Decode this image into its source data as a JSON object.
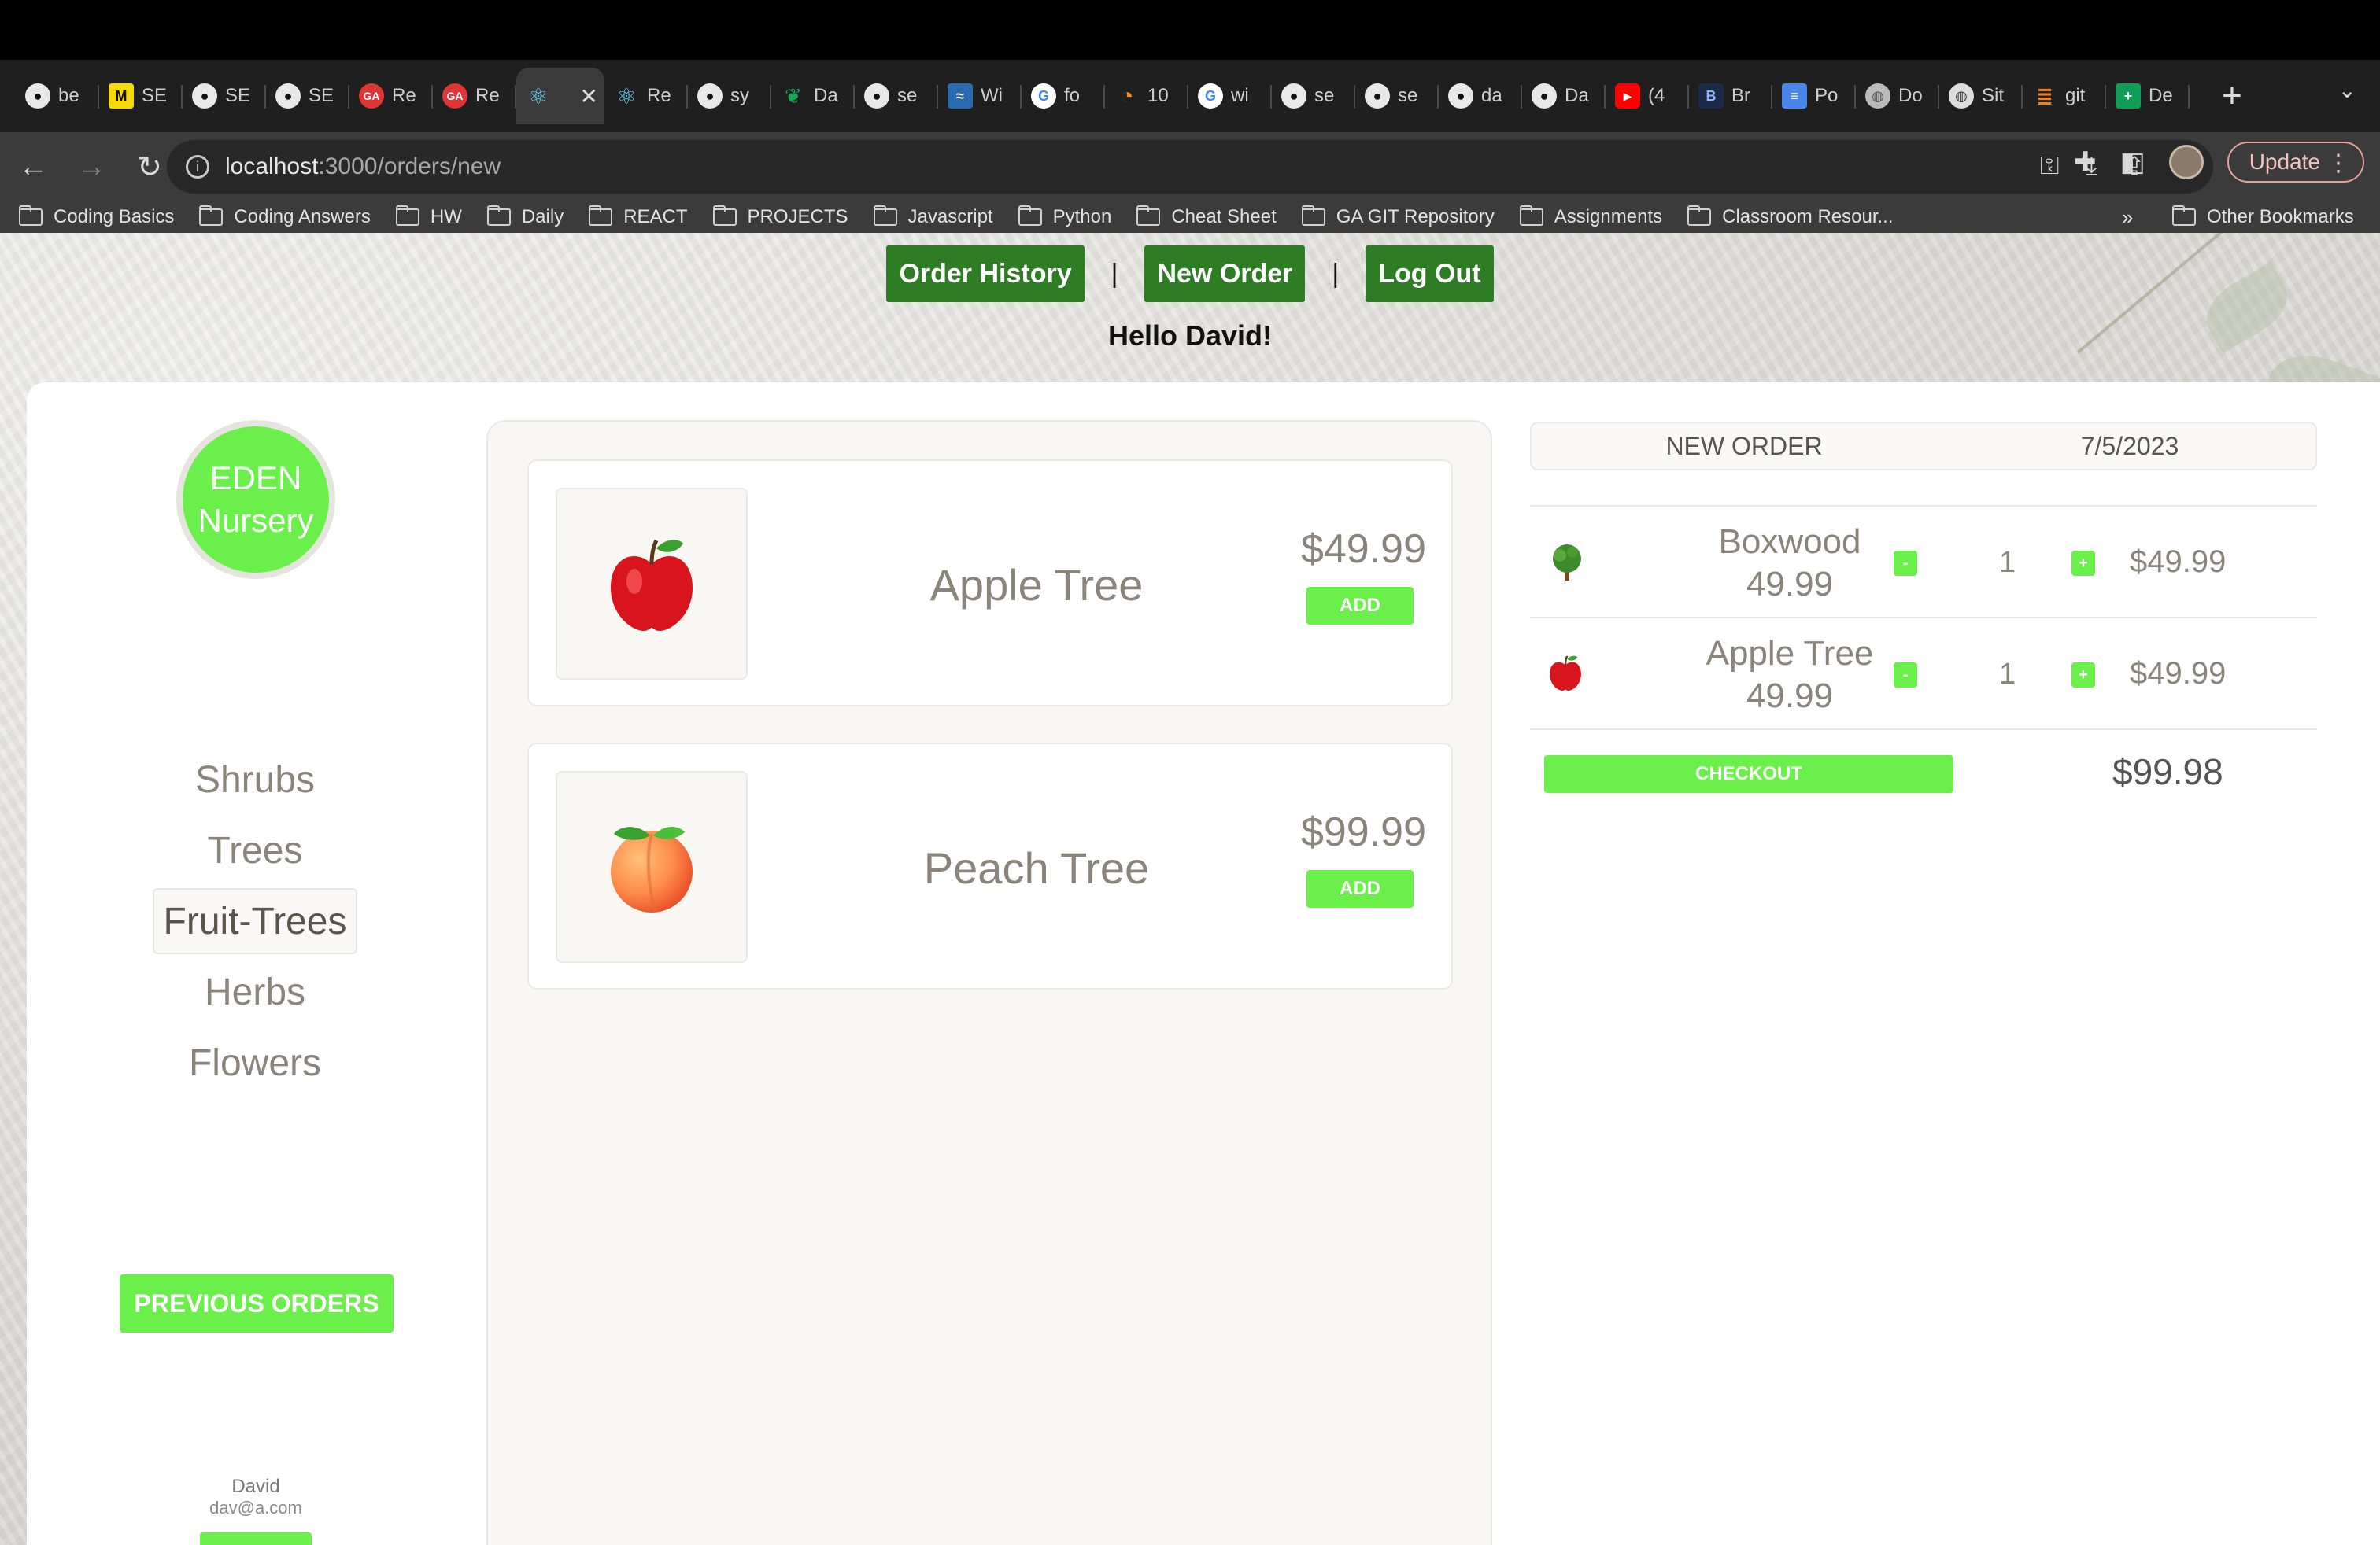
{
  "browser": {
    "tabs": [
      {
        "label": "be",
        "icon": "github-icon"
      },
      {
        "label": "SE",
        "icon": "miro-icon"
      },
      {
        "label": "SE",
        "icon": "github-icon"
      },
      {
        "label": "SE",
        "icon": "github-icon"
      },
      {
        "label": "Re",
        "icon": "ga-icon"
      },
      {
        "label": "Re",
        "icon": "ga-icon"
      },
      {
        "label": "",
        "icon": "react-icon",
        "active": true
      },
      {
        "label": "Re",
        "icon": "react-icon"
      },
      {
        "label": "sy",
        "icon": "github-icon"
      },
      {
        "label": "Da",
        "icon": "mongodb-icon"
      },
      {
        "label": "se",
        "icon": "github-icon"
      },
      {
        "label": "Wi",
        "icon": "wave-icon"
      },
      {
        "label": "fo",
        "icon": "google-icon"
      },
      {
        "label": "10",
        "icon": "timer-icon"
      },
      {
        "label": "wi",
        "icon": "google-icon"
      },
      {
        "label": "se",
        "icon": "github-icon"
      },
      {
        "label": "se",
        "icon": "github-icon"
      },
      {
        "label": "da",
        "icon": "github-icon"
      },
      {
        "label": "Da",
        "icon": "github-icon"
      },
      {
        "label": "(4",
        "icon": "youtube-icon"
      },
      {
        "label": "Br",
        "icon": "b-icon"
      },
      {
        "label": "Po",
        "icon": "docs-icon"
      },
      {
        "label": "Do",
        "icon": "globe-icon"
      },
      {
        "label": "Sit",
        "icon": "globe-icon"
      },
      {
        "label": "git",
        "icon": "stackoverflow-icon"
      },
      {
        "label": "De",
        "icon": "sheets-icon"
      }
    ],
    "url_host": "localhost",
    "url_path": ":3000/orders/new",
    "update_label": "Update",
    "bookmarks": [
      "Coding Basics",
      "Coding Answers",
      "HW",
      "Daily",
      "REACT",
      "PROJECTS",
      "Javascript",
      "Python",
      "Cheat Sheet",
      "GA GIT Repository",
      "Assignments",
      "Classroom Resour..."
    ],
    "bookmarks_more": "»",
    "other_bookmarks": "Other Bookmarks"
  },
  "header": {
    "links": [
      "Order History",
      "New Order",
      "Log Out"
    ],
    "separator": "|",
    "greeting": "Hello David!"
  },
  "sidebar": {
    "logo_line1": "EDEN",
    "logo_line2": "Nursery",
    "categories": [
      "Shrubs",
      "Trees",
      "Fruit-Trees",
      "Herbs",
      "Flowers"
    ],
    "active_category": "Fruit-Trees",
    "previous_orders_label": "PREVIOUS ORDERS",
    "user_name": "David",
    "user_email": "dav@a.com"
  },
  "menu": {
    "items": [
      {
        "emoji": "🍎",
        "name": "Apple Tree",
        "price": "$49.99",
        "add_label": "ADD"
      },
      {
        "emoji": "🍑",
        "name": "Peach Tree",
        "price": "$99.99",
        "add_label": "ADD"
      }
    ]
  },
  "order": {
    "title": "NEW ORDER",
    "date": "7/5/2023",
    "line_items": [
      {
        "emoji": "🌳",
        "name": "Boxwood",
        "unit_price": "49.99",
        "minus": "-",
        "qty": "1",
        "plus": "+",
        "price": "$49.99"
      },
      {
        "emoji": "🍎",
        "name": "Apple Tree",
        "unit_price": "49.99",
        "minus": "-",
        "qty": "1",
        "plus": "+",
        "price": "$49.99"
      }
    ],
    "checkout_label": "CHECKOUT",
    "total": "$99.98"
  },
  "colors": {
    "accent_green": "#6bef4a",
    "nav_green": "#2e7d25",
    "text_muted": "#8a847b"
  }
}
